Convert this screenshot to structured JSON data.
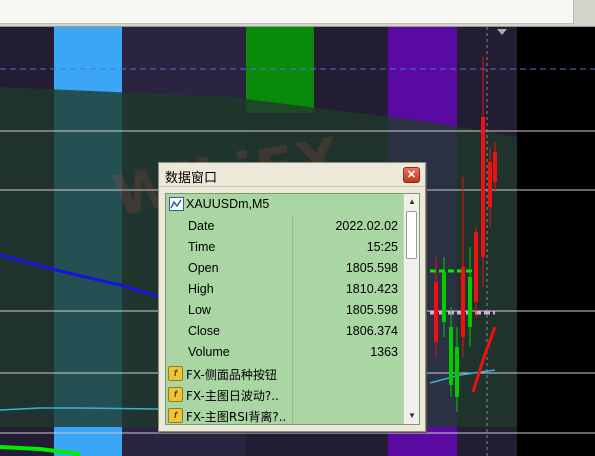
{
  "window": {
    "title": "数据窗口",
    "close_glyph": "✕"
  },
  "watermark": "WikiFX",
  "symbol_row": {
    "label": "XAUUSDm,M5",
    "icon": "chart-line-icon"
  },
  "rows": [
    {
      "label": "Date",
      "value": "2022.02.02"
    },
    {
      "label": "Time",
      "value": "15:25"
    },
    {
      "label": "Open",
      "value": "1805.598"
    },
    {
      "label": "High",
      "value": "1810.423"
    },
    {
      "label": "Low",
      "value": "1805.598"
    },
    {
      "label": "Close",
      "value": "1806.374"
    },
    {
      "label": "Volume",
      "value": "1363"
    }
  ],
  "indicators": [
    {
      "label": "FX-侧面品种按钮",
      "icon": "indicator-icon"
    },
    {
      "label": "FX-主图日波动?..",
      "icon": "indicator-icon"
    },
    {
      "label": "FX-主图RSI背离?..",
      "icon": "indicator-icon"
    }
  ],
  "colors": {
    "chart_bg": "#221d33",
    "list_bg": "#a9d6a2",
    "bull_candle": "#00cc00",
    "bear_candle": "#ee1111",
    "ma_blue": "#1515dd",
    "band_light_blue": "#3aa6f5",
    "band_green": "#0a8a0a",
    "band_purple": "#5a0aa0"
  }
}
